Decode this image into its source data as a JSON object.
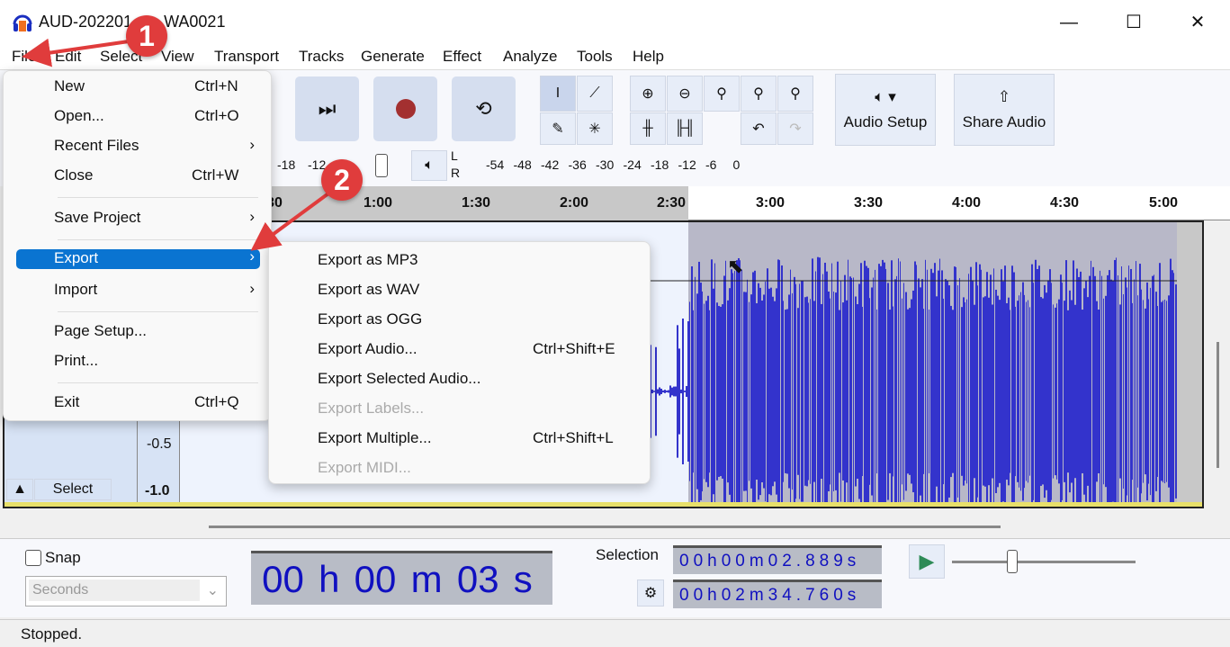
{
  "window": {
    "title": "AUD-202201",
    "title_suffix": "WA0021",
    "min": "—",
    "max": "☐",
    "close": "✕"
  },
  "menubar": [
    "File",
    "Edit",
    "Select",
    "View",
    "Transport",
    "Tracks",
    "Generate",
    "Effect",
    "Analyze",
    "Tools",
    "Help"
  ],
  "toolbar": {
    "audio_setup": "Audio Setup",
    "share_audio": "Share Audio"
  },
  "meters": {
    "rec_ticks": [
      "-18",
      "-12",
      "-6"
    ],
    "lr": [
      "L",
      "R"
    ],
    "play_ticks": [
      "-54",
      "-48",
      "-42",
      "-36",
      "-30",
      "-24",
      "-18",
      "-12",
      "-6",
      "0"
    ]
  },
  "ruler": [
    "30",
    "1:00",
    "1:30",
    "2:00",
    "2:30",
    "3:00",
    "3:30",
    "4:00",
    "4:30",
    "5:00"
  ],
  "track": {
    "scale": [
      "-0.5",
      "-1.0"
    ],
    "select_button": "Select"
  },
  "file_menu": [
    {
      "label": "New",
      "shortcut": "Ctrl+N"
    },
    {
      "label": "Open...",
      "shortcut": "Ctrl+O"
    },
    {
      "label": "Recent Files",
      "submenu": true
    },
    {
      "label": "Close",
      "shortcut": "Ctrl+W"
    },
    {
      "label": "Save Project",
      "submenu": true
    },
    {
      "label": "Export",
      "submenu": true,
      "highlighted": true
    },
    {
      "label": "Import",
      "submenu": true
    },
    {
      "label": "Page Setup..."
    },
    {
      "label": "Print..."
    },
    {
      "label": "Exit",
      "shortcut": "Ctrl+Q"
    }
  ],
  "export_menu": [
    {
      "label": "Export as MP3"
    },
    {
      "label": "Export as WAV"
    },
    {
      "label": "Export as OGG"
    },
    {
      "label": "Export Audio...",
      "shortcut": "Ctrl+Shift+E"
    },
    {
      "label": "Export Selected Audio..."
    },
    {
      "label": "Export Labels...",
      "disabled": true
    },
    {
      "label": "Export Multiple...",
      "shortcut": "Ctrl+Shift+L"
    },
    {
      "label": "Export MIDI...",
      "disabled": true
    }
  ],
  "bottom": {
    "snap_label": "Snap",
    "snap_checked": false,
    "snap_unit": "Seconds",
    "time": [
      "00",
      "h",
      "00",
      "m",
      "03",
      "s"
    ],
    "selection_label": "Selection",
    "sel_start": "00h00m02.889s",
    "sel_end": "00h02m34.760s"
  },
  "status": "Stopped.",
  "annotations": [
    "1",
    "2"
  ],
  "colors": {
    "accent": "#0a74d1",
    "waveform": "#3333cc",
    "badge": "#e03c3c",
    "record": "#a33030"
  }
}
